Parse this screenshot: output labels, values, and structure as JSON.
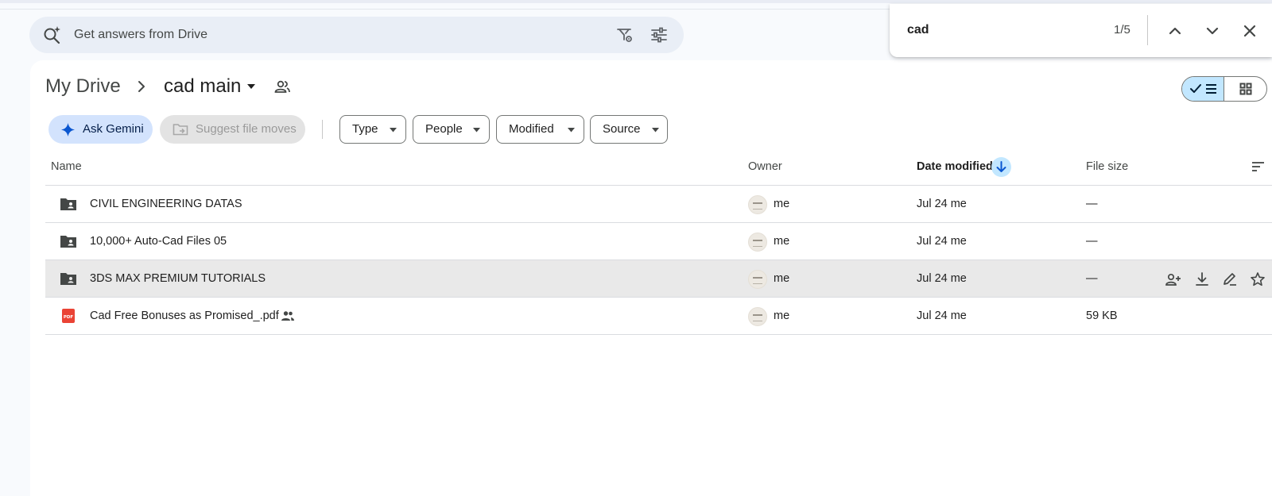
{
  "search": {
    "placeholder": "Get answers from Drive",
    "search_icon": "sparkle-search-icon",
    "settings_icon": "search-settings-icon",
    "filter_icon": "tune-icon"
  },
  "find_in_page": {
    "query": "cad",
    "count": "1/5",
    "icons": [
      "chevron-up-icon",
      "chevron-down-icon",
      "close-icon"
    ]
  },
  "breadcrumb": {
    "root": "My Drive",
    "current": "cad main",
    "icons": [
      "chevron-right-icon",
      "caret-down-icon",
      "shared-folder-people-icon"
    ]
  },
  "view_toggle": {
    "selected": "list",
    "icons": [
      "check-icon",
      "list-view-icon",
      "grid-view-icon"
    ]
  },
  "toolbar": {
    "ask_gemini": "Ask Gemini",
    "suggest_moves": "Suggest file moves"
  },
  "filters": [
    {
      "label": "Type"
    },
    {
      "label": "People"
    },
    {
      "label": "Modified"
    },
    {
      "label": "Source"
    }
  ],
  "table": {
    "headers": {
      "name": "Name",
      "owner": "Owner",
      "date_modified": "Date modified",
      "file_size": "File size"
    },
    "sort": "date_modified_descending",
    "rows": [
      {
        "name": "CIVIL ENGINEERING DATAS",
        "icon": "shared-folder-icon",
        "owner": "me",
        "modified": "Jul 24 me",
        "size": "—",
        "shared": false,
        "selected": false
      },
      {
        "name": "10,000+ Auto-Cad Files 05",
        "icon": "shared-folder-icon",
        "owner": "me",
        "modified": "Jul 24 me",
        "size": "—",
        "shared": false,
        "selected": false
      },
      {
        "name": "3DS MAX PREMIUM TUTORIALS",
        "icon": "shared-folder-icon",
        "owner": "me",
        "modified": "Jul 24 me",
        "size": "—",
        "shared": false,
        "selected": true
      },
      {
        "name": "Cad Free Bonuses as Promised_.pdf",
        "icon": "pdf-icon",
        "owner": "me",
        "modified": "Jul 24 me",
        "size": "59 KB",
        "shared": true,
        "selected": false
      }
    ],
    "row_actions": [
      "share-icon",
      "download-icon",
      "rename-icon",
      "star-icon"
    ]
  },
  "colors": {
    "accent": "#c2e7ff",
    "gemini_chip": "#d3e3fd",
    "pdf_red": "#ea4335",
    "folder_dark": "#444746"
  }
}
